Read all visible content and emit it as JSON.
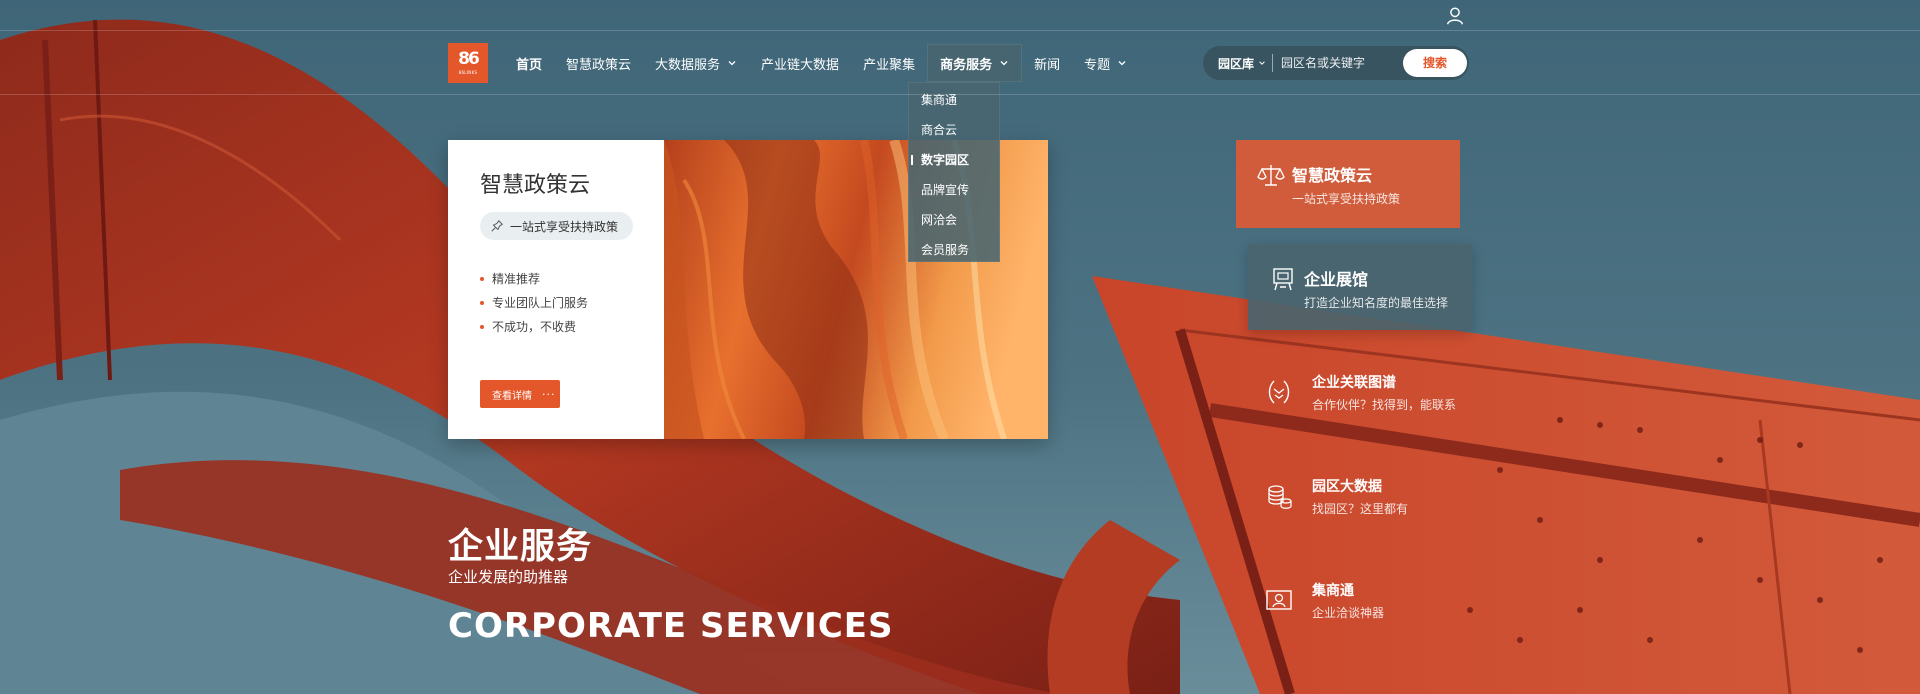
{
  "brand": {
    "logo_glyph": "86",
    "logo_text": "86LINKS",
    "accent_color": "#e3572b"
  },
  "nav": {
    "items": [
      {
        "label": "首页",
        "active": true
      },
      {
        "label": "智慧政策云"
      },
      {
        "label": "大数据服务",
        "has_dropdown": true
      },
      {
        "label": "产业链大数据"
      },
      {
        "label": "产业聚集"
      },
      {
        "label": "商务服务",
        "has_dropdown": true,
        "open": true
      },
      {
        "label": "新闻"
      },
      {
        "label": "专题",
        "has_dropdown": true
      }
    ],
    "dropdown": {
      "items": [
        {
          "label": "集商通"
        },
        {
          "label": "商合云"
        },
        {
          "label": "数字园区",
          "active": true
        },
        {
          "label": "品牌宣传"
        },
        {
          "label": "网洽会"
        },
        {
          "label": "会员服务"
        }
      ]
    }
  },
  "search": {
    "scope_label": "园区库",
    "placeholder": "园区名或关键字",
    "button_label": "搜索"
  },
  "feature_card": {
    "title": "智慧政策云",
    "pill": "一站式享受扶持政策",
    "bullets": [
      "精准推荐",
      "专业团队上门服务",
      "不成功，不收费"
    ],
    "button_label": "查看详情",
    "button_dots": "···"
  },
  "hero": {
    "title": "企业服务",
    "subtitle": "企业发展的助推器",
    "english": "CORPORATE SERVICES"
  },
  "services": [
    {
      "title": "智慧政策云",
      "desc": "一站式享受扶持政策",
      "icon": "scale-icon",
      "active": true
    },
    {
      "title": "企业展馆",
      "desc": "打造企业知名度的最佳选择",
      "icon": "exhibition-icon"
    },
    {
      "title": "企业关联图谱",
      "desc": "合作伙伴？找得到，能联系",
      "icon": "handshake-icon"
    },
    {
      "title": "园区大数据",
      "desc": "找园区？这里都有",
      "icon": "database-icon"
    },
    {
      "title": "集商通",
      "desc": "企业洽谈神器",
      "icon": "contact-card-icon"
    }
  ]
}
